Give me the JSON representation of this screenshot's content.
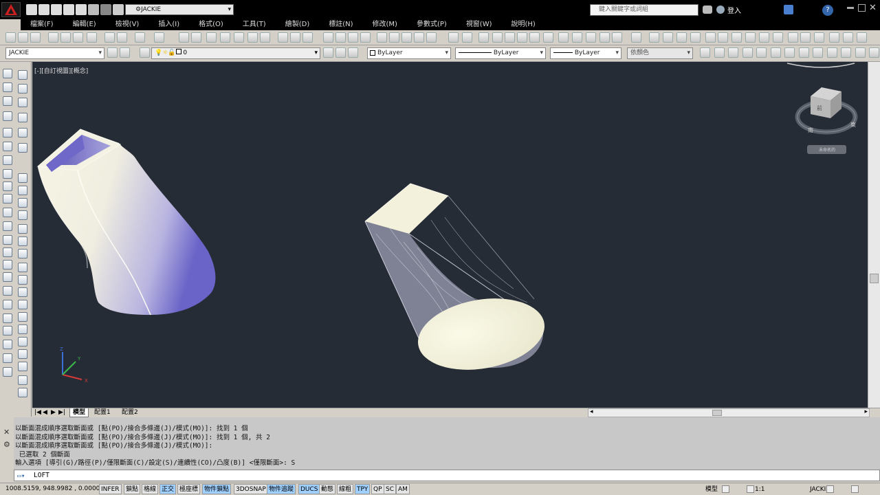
{
  "title_bar": {
    "workspace": "JACKIE",
    "search_placeholder": "鍵入關鍵字或詞組",
    "login": "登入"
  },
  "menu": [
    "檔案(F)",
    "編輯(E)",
    "檢視(V)",
    "插入(I)",
    "格式(O)",
    "工具(T)",
    "繪製(D)",
    "標註(N)",
    "修改(M)",
    "參數式(P)",
    "視窗(W)",
    "說明(H)"
  ],
  "props_toolbar": {
    "layer_state": "JACKIE",
    "layer": "0",
    "color": "ByLayer",
    "linetype": "ByLayer",
    "lineweight": "ByLayer",
    "plotstyle": "依顏色"
  },
  "viewport": {
    "label": "[-][自訂視圖][概念]",
    "viewcube_label": "前",
    "south_label": "南",
    "east_label": "東",
    "wcs": "未命名的",
    "axes": [
      "X",
      "Y",
      "Z"
    ]
  },
  "layout_tabs": [
    "模型",
    "配置1",
    "配置2"
  ],
  "command_history": [
    "以斷面混成順序選取斷面或 [點(PO)/接合多條邊(J)/模式(MO)]: 找到 1 個",
    "以斷面混成順序選取斷面或 [點(PO)/接合多條邊(J)/模式(MO)]: 找到 1 個, 共 2",
    "以斷面混成順序選取斷面或 [點(PO)/接合多條邊(J)/模式(MO)]:",
    " 已選取 2 個斷面",
    "輸入選項 [導引(G)/路徑(P)/僅限斷面(C)/設定(S)/連續性(CO)/凸度(B)] <僅限斷面>: S"
  ],
  "command_prompt": "LOFT",
  "status": {
    "coords": "1008.5159, 948.9982 , 0.0000",
    "toggles": [
      {
        "label": "INFER",
        "on": false
      },
      {
        "label": "鎖點",
        "on": false
      },
      {
        "label": "格線",
        "on": false
      },
      {
        "label": "正交",
        "on": true
      },
      {
        "label": "極座標",
        "on": false
      },
      {
        "label": "物件鎖點",
        "on": true
      },
      {
        "label": "3DOSNAP",
        "on": false
      },
      {
        "label": "物件追蹤",
        "on": true
      },
      {
        "label": "DUCS",
        "on": true
      },
      {
        "label": "動態",
        "on": false
      },
      {
        "label": "線粗",
        "on": false
      },
      {
        "label": "TPY",
        "on": true
      },
      {
        "label": "QP",
        "on": false
      },
      {
        "label": "SC",
        "on": false
      },
      {
        "label": "AM",
        "on": false
      }
    ],
    "right_labels": {
      "model": "模型",
      "scale": "1:1",
      "workspace": "JACKIE"
    }
  },
  "colors": {
    "viewport_bg": "#262c36",
    "accent_red": "#cc1f1f"
  }
}
